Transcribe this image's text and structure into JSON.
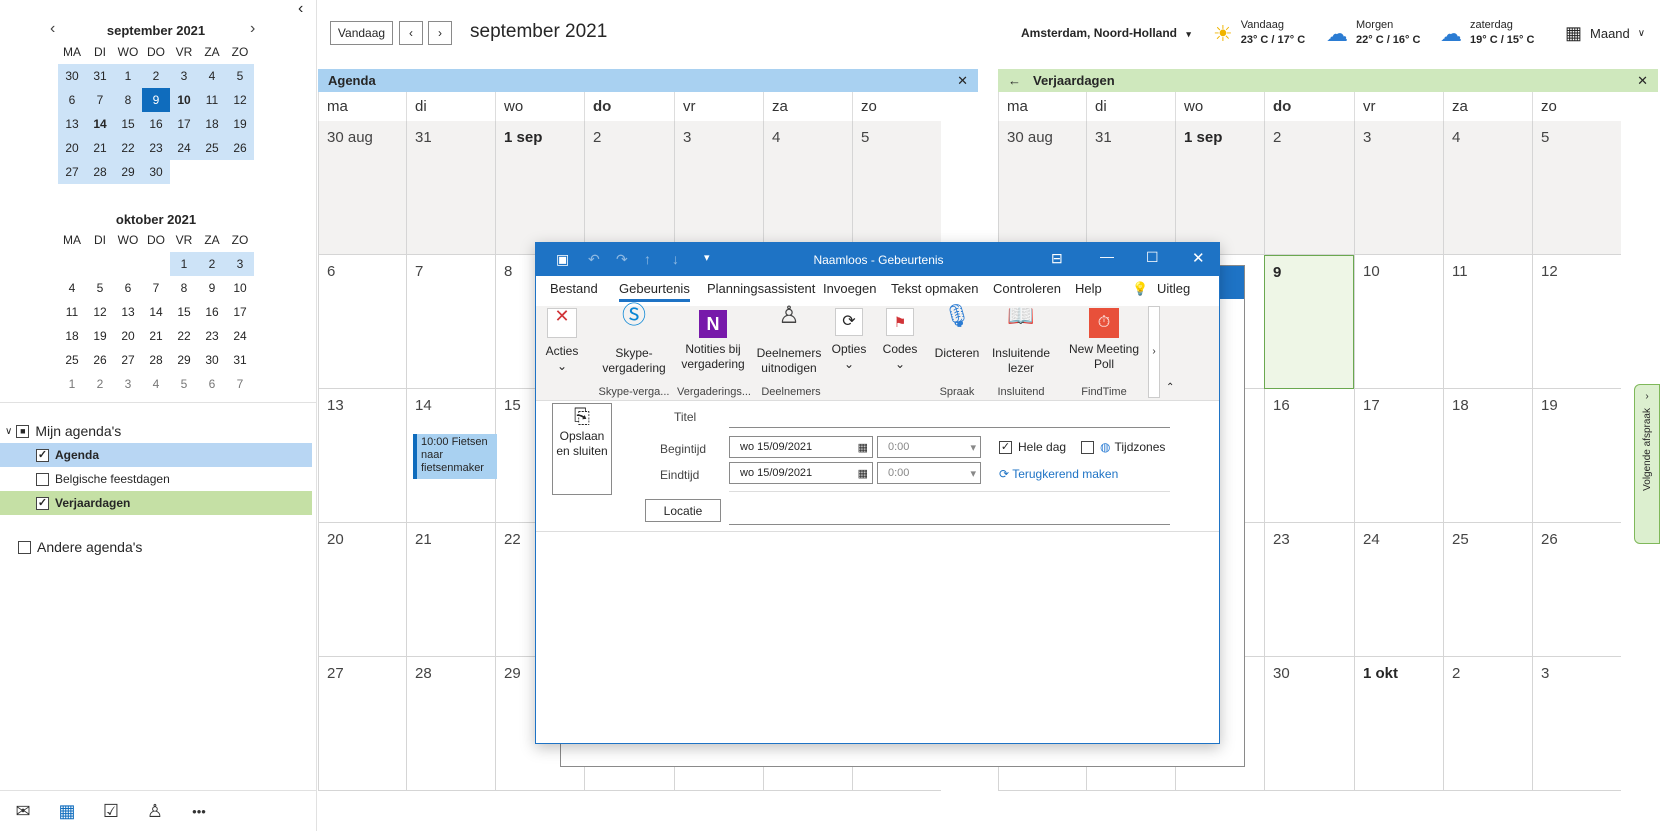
{
  "sidebar": {
    "collapse_glyph": "‹",
    "sep": {
      "title": "september 2021",
      "weekdays": [
        "MA",
        "DI",
        "WO",
        "DO",
        "VR",
        "ZA",
        "ZO"
      ],
      "days": [
        [
          "30",
          "31",
          "1",
          "2",
          "3",
          "4",
          "5"
        ],
        [
          "6",
          "7",
          "8",
          "9",
          "10",
          "11",
          "12"
        ],
        [
          "13",
          "14",
          "15",
          "16",
          "17",
          "18",
          "19"
        ],
        [
          "20",
          "21",
          "22",
          "23",
          "24",
          "25",
          "26"
        ],
        [
          "27",
          "28",
          "29",
          "30"
        ]
      ]
    },
    "oct": {
      "title": "oktober 2021",
      "weekdays": [
        "MA",
        "DI",
        "WO",
        "DO",
        "VR",
        "ZA",
        "ZO"
      ],
      "days": [
        [
          "",
          "",
          "",
          "",
          "1",
          "2",
          "3"
        ],
        [
          "4",
          "5",
          "6",
          "7",
          "8",
          "9",
          "10"
        ],
        [
          "11",
          "12",
          "13",
          "14",
          "15",
          "16",
          "17"
        ],
        [
          "18",
          "19",
          "20",
          "21",
          "22",
          "23",
          "24"
        ],
        [
          "25",
          "26",
          "27",
          "28",
          "29",
          "30",
          "31"
        ],
        [
          "1",
          "2",
          "3",
          "4",
          "5",
          "6",
          "7"
        ]
      ]
    },
    "groups": {
      "mine": "Mijn agenda's",
      "agenda": "Agenda",
      "feest": "Belgische feestdagen",
      "verj": "Verjaardagen",
      "other": "Andere agenda's"
    },
    "nav": {
      "mail": "✉",
      "calendar": "▦",
      "tasks": "☑",
      "people": "♙",
      "more": "•••"
    }
  },
  "topbar": {
    "today": "Vandaag",
    "title": "september 2021",
    "location": "Amsterdam, Noord-Holland",
    "weather": [
      {
        "day": "Vandaag",
        "temp": "23° C / 17° C",
        "icon": "sun-icon",
        "glyph": "☀"
      },
      {
        "day": "Morgen",
        "temp": "22° C / 16° C",
        "icon": "rain-cloud-icon",
        "glyph": "☁"
      },
      {
        "day": "zaterdag",
        "temp": "19° C / 15° C",
        "icon": "rain-cloud-icon",
        "glyph": "☁"
      }
    ],
    "view": "Maand"
  },
  "left_panel": {
    "title": "Agenda",
    "close": "✕",
    "days": [
      "ma",
      "di",
      "wo",
      "do",
      "vr",
      "za",
      "zo"
    ],
    "weeks": [
      [
        "30 aug",
        "31",
        "1 sep",
        "2",
        "3",
        "4",
        "5"
      ],
      [
        "6",
        "7",
        "8",
        "",
        "",
        "",
        ""
      ],
      [
        "13",
        "14",
        "15",
        "",
        "",
        "",
        ""
      ],
      [
        "20",
        "21",
        "22",
        "",
        "",
        "",
        ""
      ],
      [
        "27",
        "28",
        "29",
        "",
        "",
        "",
        ""
      ]
    ],
    "event": "10:00 Fietsen naar fietsenmaker"
  },
  "right_panel": {
    "title": "Verjaardagen",
    "back": "←",
    "close": "✕",
    "days": [
      "ma",
      "di",
      "wo",
      "do",
      "vr",
      "za",
      "zo"
    ],
    "weeks": [
      [
        "30 aug",
        "31",
        "1 sep",
        "2",
        "3",
        "4",
        "5"
      ],
      [
        "",
        "",
        "",
        "9",
        "10",
        "11",
        "12"
      ],
      [
        "",
        "",
        "",
        "16",
        "17",
        "18",
        "19"
      ],
      [
        "",
        "",
        "",
        "23",
        "24",
        "25",
        "26"
      ],
      [
        "",
        "",
        "",
        "30",
        "1 okt",
        "2",
        "3"
      ]
    ],
    "side_tab": "Volgende afspraak"
  },
  "dialog": {
    "title": "Naamloos  -  Gebeurtenis",
    "tabs": [
      "Bestand",
      "Gebeurtenis",
      "Planningsassistent",
      "Invoegen",
      "Tekst opmaken",
      "Controleren",
      "Help",
      "Uitleg"
    ],
    "ribbon": {
      "acties": "Acties",
      "skype": "Skype-vergadering",
      "notities": "Notities bij vergadering",
      "deelnemers": "Deelnemers uitnodigen",
      "opties": "Opties",
      "codes": "Codes",
      "dicteren": "Dicteren",
      "lezer": "Insluitende lezer",
      "poll": "New Meeting Poll"
    },
    "groups": {
      "skype": "Skype-verga...",
      "verg": "Vergaderings...",
      "deel": "Deelnemers",
      "spraak": "Spraak",
      "insl": "Insluitend",
      "find": "FindTime"
    },
    "form": {
      "save": "Opslaan en sluiten",
      "titel": "Titel",
      "begintijd": "Begintijd",
      "eindtijd": "Eindtijd",
      "start_date": "wo 15/09/2021",
      "end_date": "wo 15/09/2021",
      "start_time": "0:00",
      "end_time": "0:00",
      "heledag": "Hele dag",
      "tijdzones": "Tijdzones",
      "terugkerend": "Terugkerend maken",
      "locatie": "Locatie"
    }
  }
}
